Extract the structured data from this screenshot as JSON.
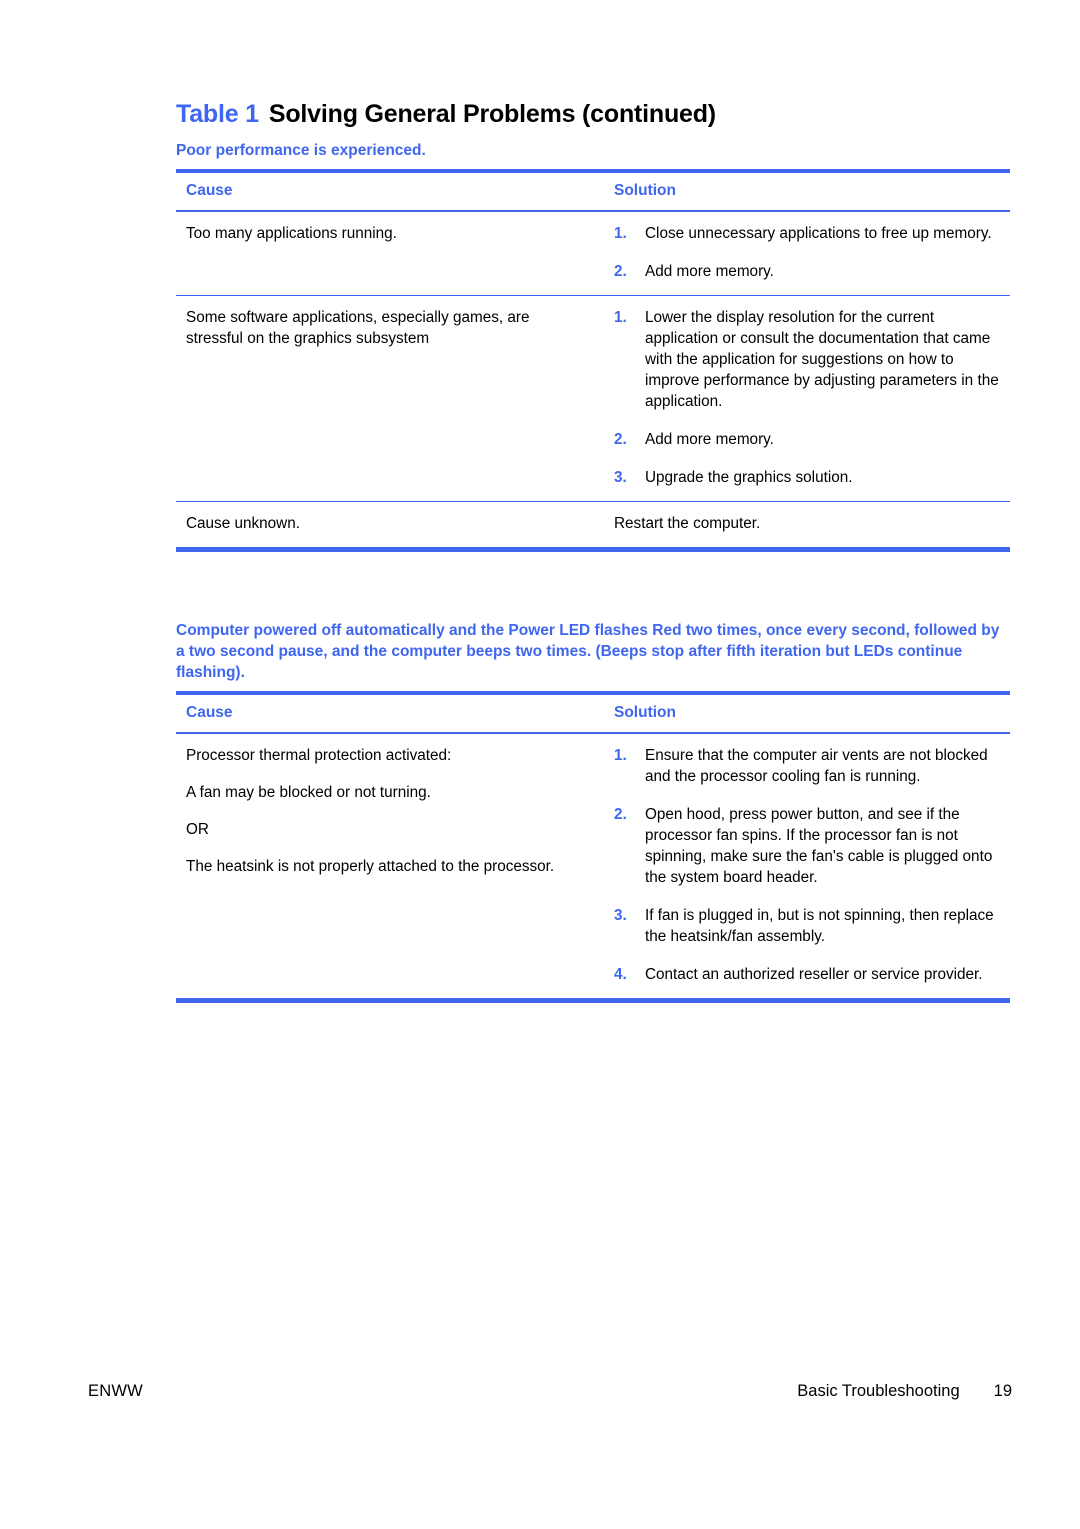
{
  "document": {
    "title_prefix": "Table 1",
    "title_text": "Solving General Problems (continued)"
  },
  "tables": [
    {
      "caption": "Poor performance is experienced.",
      "headers": {
        "cause": "Cause",
        "solution": "Solution"
      },
      "rows": [
        {
          "cause_paragraphs": [
            "Too many applications running."
          ],
          "solution_type": "list",
          "solution_items": [
            {
              "num": "1.",
              "text": "Close unnecessary applications to free up memory."
            },
            {
              "num": "2.",
              "text": "Add more memory."
            }
          ]
        },
        {
          "cause_paragraphs": [
            "Some software applications, especially games, are stressful on the graphics subsystem"
          ],
          "solution_type": "list",
          "solution_items": [
            {
              "num": "1.",
              "text": "Lower the display resolution for the current application or consult the documentation that came with the application for suggestions on how to improve performance by adjusting parameters in the application."
            },
            {
              "num": "2.",
              "text": "Add more memory."
            },
            {
              "num": "3.",
              "text": "Upgrade the graphics solution."
            }
          ]
        },
        {
          "cause_paragraphs": [
            "Cause unknown."
          ],
          "solution_type": "plain",
          "solution_text": "Restart the computer."
        }
      ]
    },
    {
      "caption": "Computer powered off automatically and the Power LED flashes Red two times, once every second, followed by a two second pause, and the computer beeps two times. (Beeps stop after fifth iteration but LEDs continue flashing).",
      "headers": {
        "cause": "Cause",
        "solution": "Solution"
      },
      "rows": [
        {
          "cause_paragraphs": [
            "Processor thermal protection activated:",
            "A fan may be blocked or not turning.",
            "OR",
            "The heatsink is not properly attached to the processor."
          ],
          "solution_type": "list",
          "solution_items": [
            {
              "num": "1.",
              "text": "Ensure that the computer air vents are not blocked and the processor cooling fan is running."
            },
            {
              "num": "2.",
              "text": "Open hood, press power button, and see if the processor fan spins. If the processor fan is not spinning, make sure the fan's cable is plugged onto the system board header."
            },
            {
              "num": "3.",
              "text": "If fan is plugged in, but is not spinning, then replace the heatsink/fan assembly."
            },
            {
              "num": "4.",
              "text": "Contact an authorized reseller or service provider."
            }
          ]
        }
      ]
    }
  ],
  "footer": {
    "left": "ENWW",
    "section": "Basic Troubleshooting",
    "page_number": "19"
  },
  "colors": {
    "accent_blue": "#3f66f0",
    "text_black": "#000000"
  }
}
